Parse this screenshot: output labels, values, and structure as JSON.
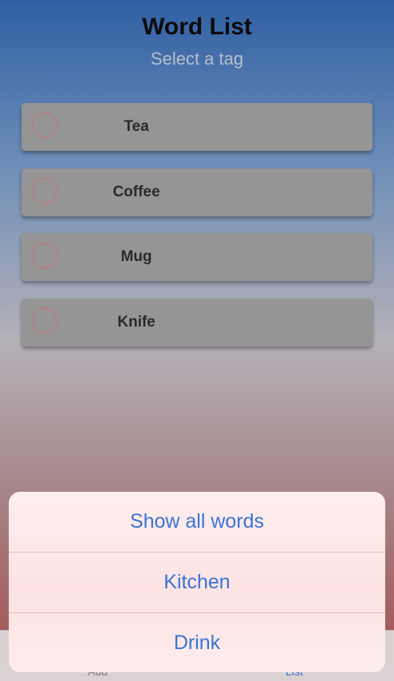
{
  "header": {
    "title": "Word List",
    "subtitle": "Select a tag"
  },
  "words": [
    {
      "label": "Tea"
    },
    {
      "label": "Coffee"
    },
    {
      "label": "Mug"
    },
    {
      "label": "Knife"
    }
  ],
  "action_sheet": {
    "options": [
      {
        "label": "Show all words"
      },
      {
        "label": "Kitchen"
      },
      {
        "label": "Drink"
      }
    ]
  },
  "tabbar": {
    "add_label": "Add",
    "list_label": "List"
  },
  "colors": {
    "accent": "#3a73d8",
    "row_background": "#959595",
    "sheet_background": "#fde3e3"
  }
}
